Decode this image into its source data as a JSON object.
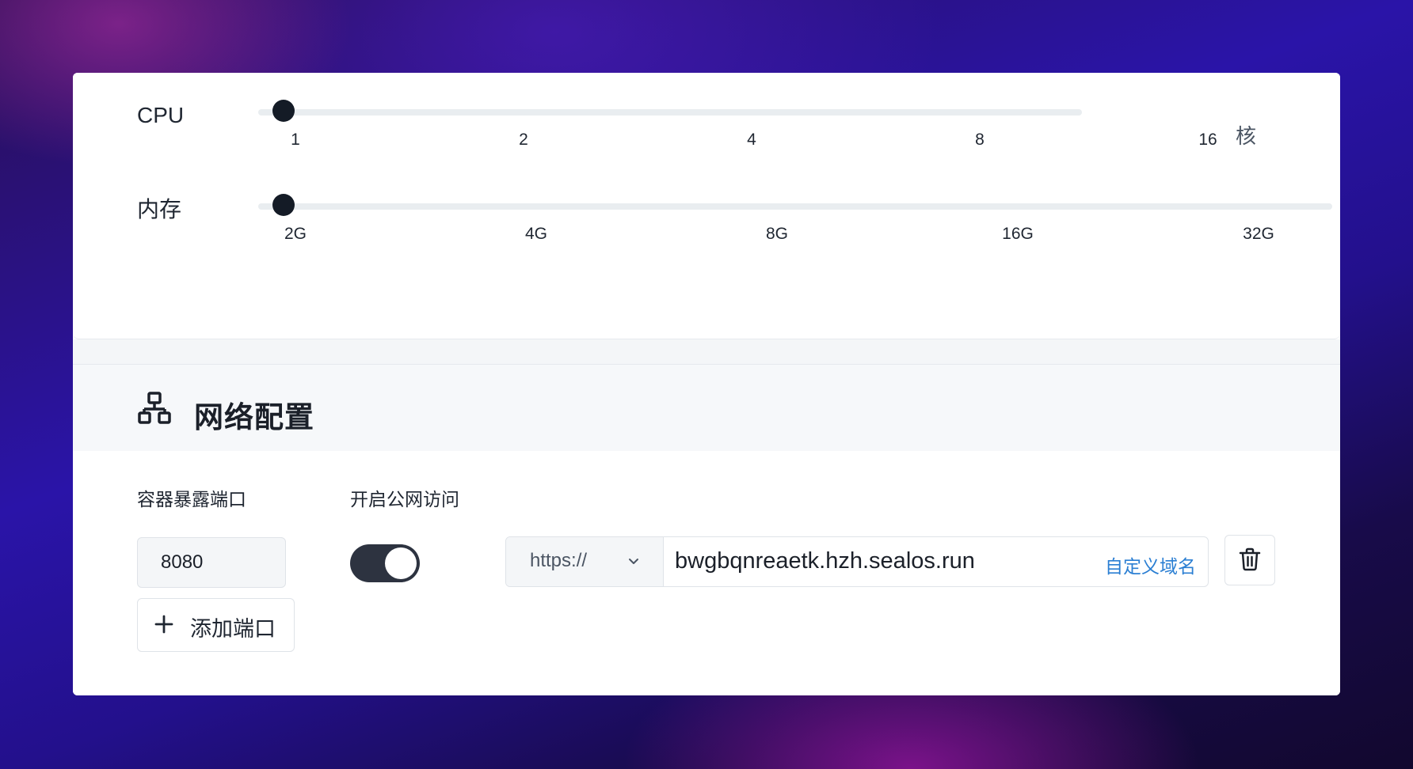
{
  "resources": {
    "cpu": {
      "label": "CPU",
      "ticks": [
        "1",
        "2",
        "4",
        "8",
        "16"
      ],
      "unit": "核",
      "selected": "1"
    },
    "memory": {
      "label": "内存",
      "ticks": [
        "2G",
        "4G",
        "8G",
        "16G",
        "32G"
      ],
      "selected": "2G"
    }
  },
  "network": {
    "title": "网络配置",
    "icon": "network-icon",
    "port_label": "容器暴露端口",
    "public_label": "开启公网访问",
    "port_value": "8080",
    "public_enabled": true,
    "protocol": "https://",
    "domain": "bwgbqnreaetk.hzh.sealos.run",
    "custom_domain_label": "自定义域名",
    "add_port_label": "添加端口"
  },
  "colors": {
    "accent_link": "#2b7fd3",
    "thumb": "#141b26",
    "toggle_on": "#2d3340"
  }
}
